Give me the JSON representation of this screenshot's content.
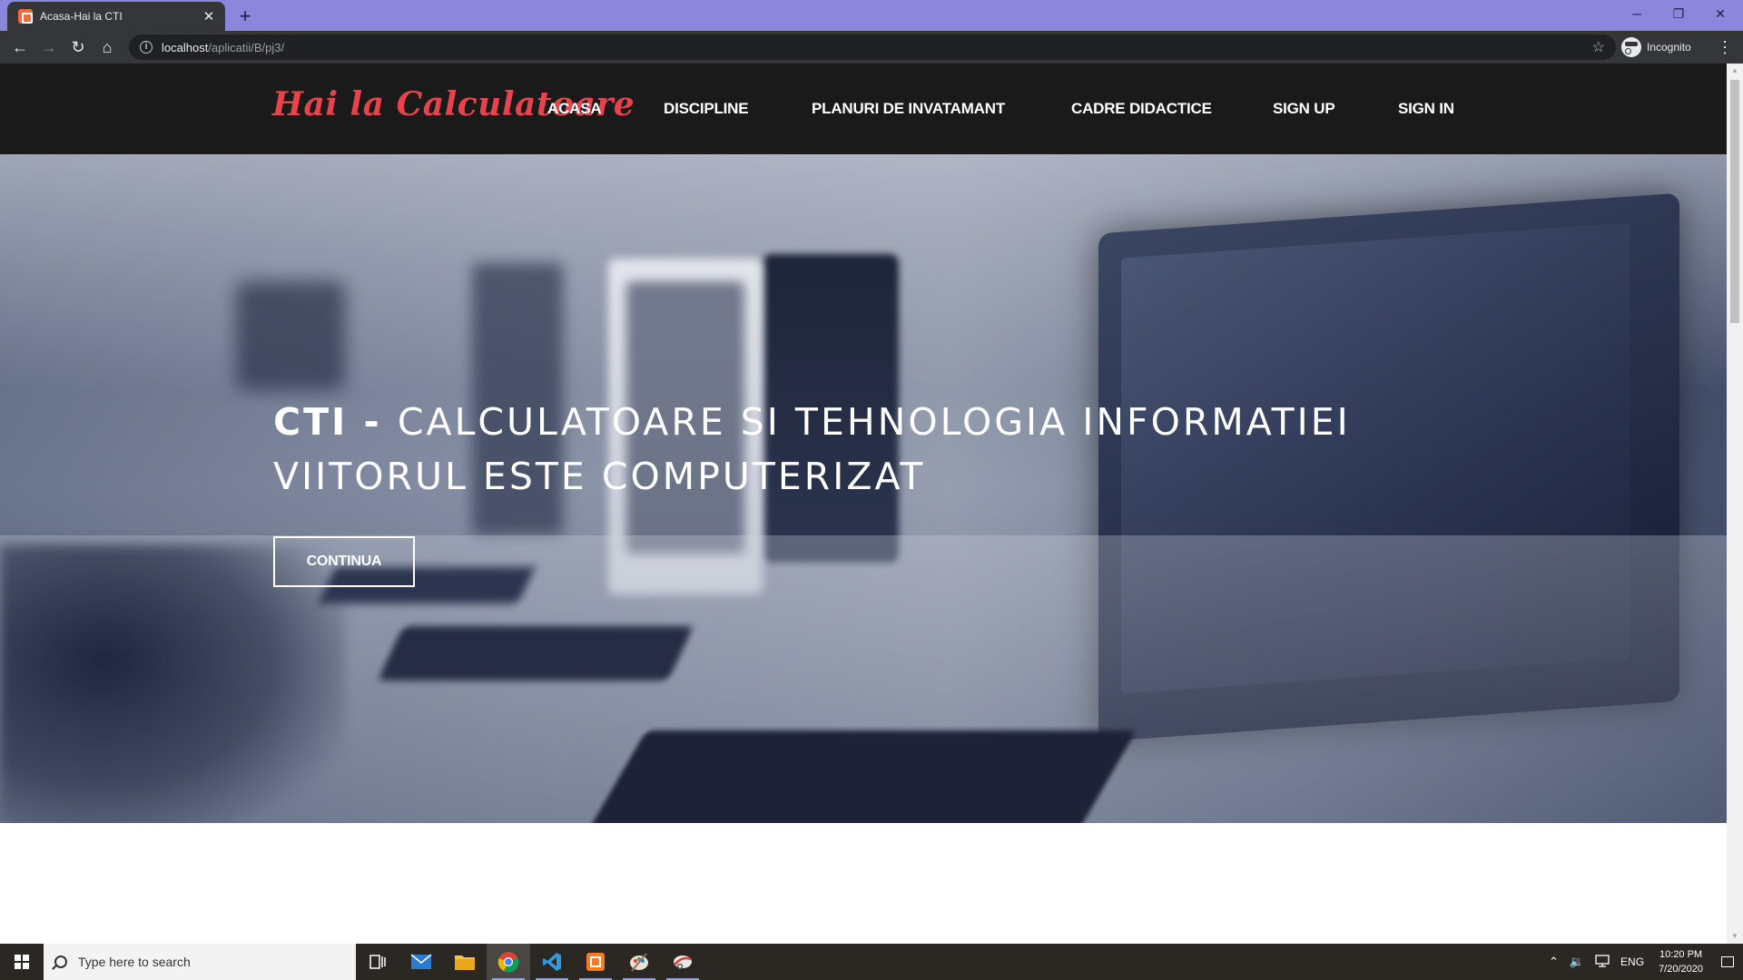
{
  "browser": {
    "tab_title": "Acasa-Hai la CTI",
    "close_tab_symbol": "✕",
    "new_tab_symbol": "+",
    "url_host": "localhost",
    "url_path": "/aplicatii/B/pj3/",
    "profile_label": "Incognito",
    "window_controls": {
      "minimize": "─",
      "restore": "❐",
      "close": "✕"
    }
  },
  "site": {
    "brand": "Hai la Calculatoare",
    "nav": [
      "ACASA",
      "DISCIPLINE",
      "PLANURI DE INVATAMANT",
      "CADRE DIDACTICE",
      "SIGN UP",
      "SIGN IN"
    ]
  },
  "hero": {
    "title_strong": "CTI - ",
    "title_line1": "CALCULATOARE SI TEHNOLOGIA INFORMATIEI",
    "title_line2": "VIITORUL ESTE COMPUTERIZAT",
    "cta_label": "CONTINUA"
  },
  "taskbar": {
    "search_placeholder": "Type here to search",
    "apps": [
      "task-view-icon",
      "mail-icon",
      "file-explorer-icon",
      "chrome-icon",
      "vscode-icon",
      "xampp-icon",
      "paint-icon",
      "snip-icon"
    ],
    "language": "ENG",
    "time": "10:20 PM",
    "date": "7/20/2020"
  },
  "colors": {
    "brand_red": "#e8434c",
    "header_bg": "#1a1a1a",
    "chrome_frame": "#8c87dc",
    "chrome_toolbar": "#35363a"
  }
}
